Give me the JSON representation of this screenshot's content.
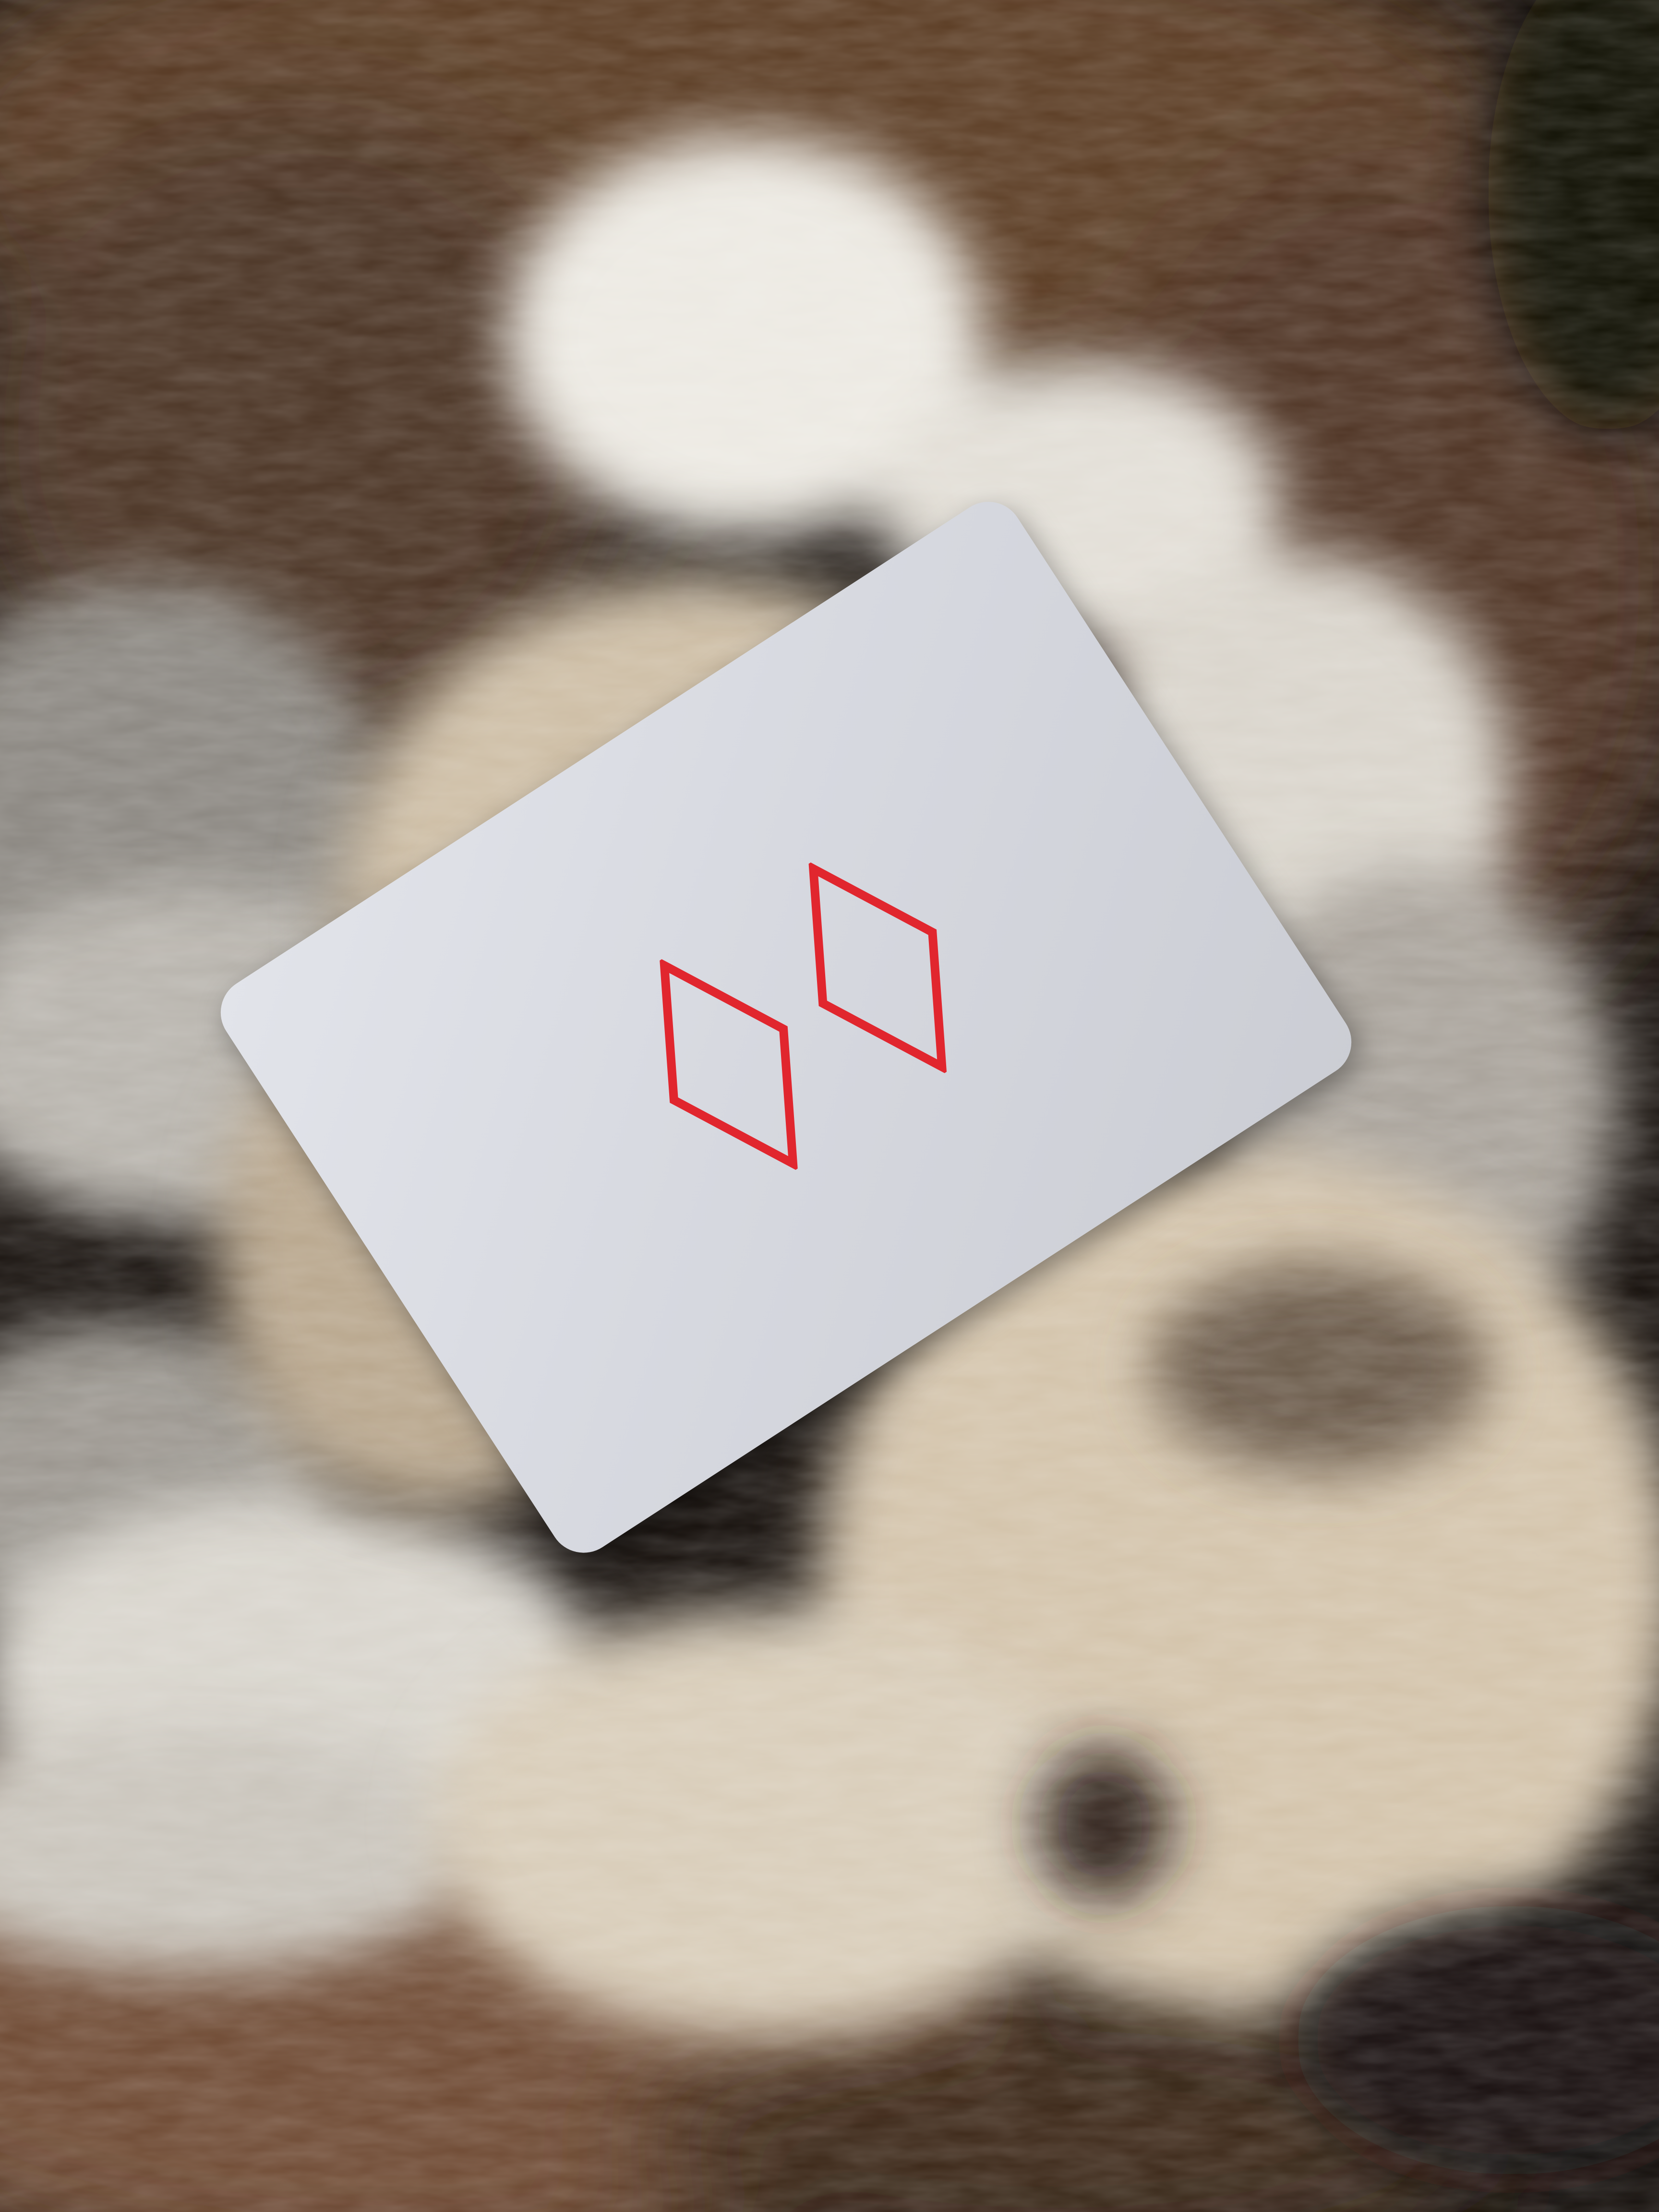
{
  "scene": {
    "subject": "playing-card",
    "background": "fur",
    "colors": {
      "card_face": "#dcdee4",
      "pip_outline": "#e1262e",
      "fur_white": "#e6e1d6",
      "fur_cream": "#c9b89f",
      "fur_brown": "#6b4428",
      "fur_dark": "#1a120c",
      "fur_grey": "#7d7a76"
    }
  },
  "card": {
    "rank": "2",
    "suit": "diamonds",
    "pip_count": 2,
    "pip_icon": "diamond-outline-icon"
  }
}
